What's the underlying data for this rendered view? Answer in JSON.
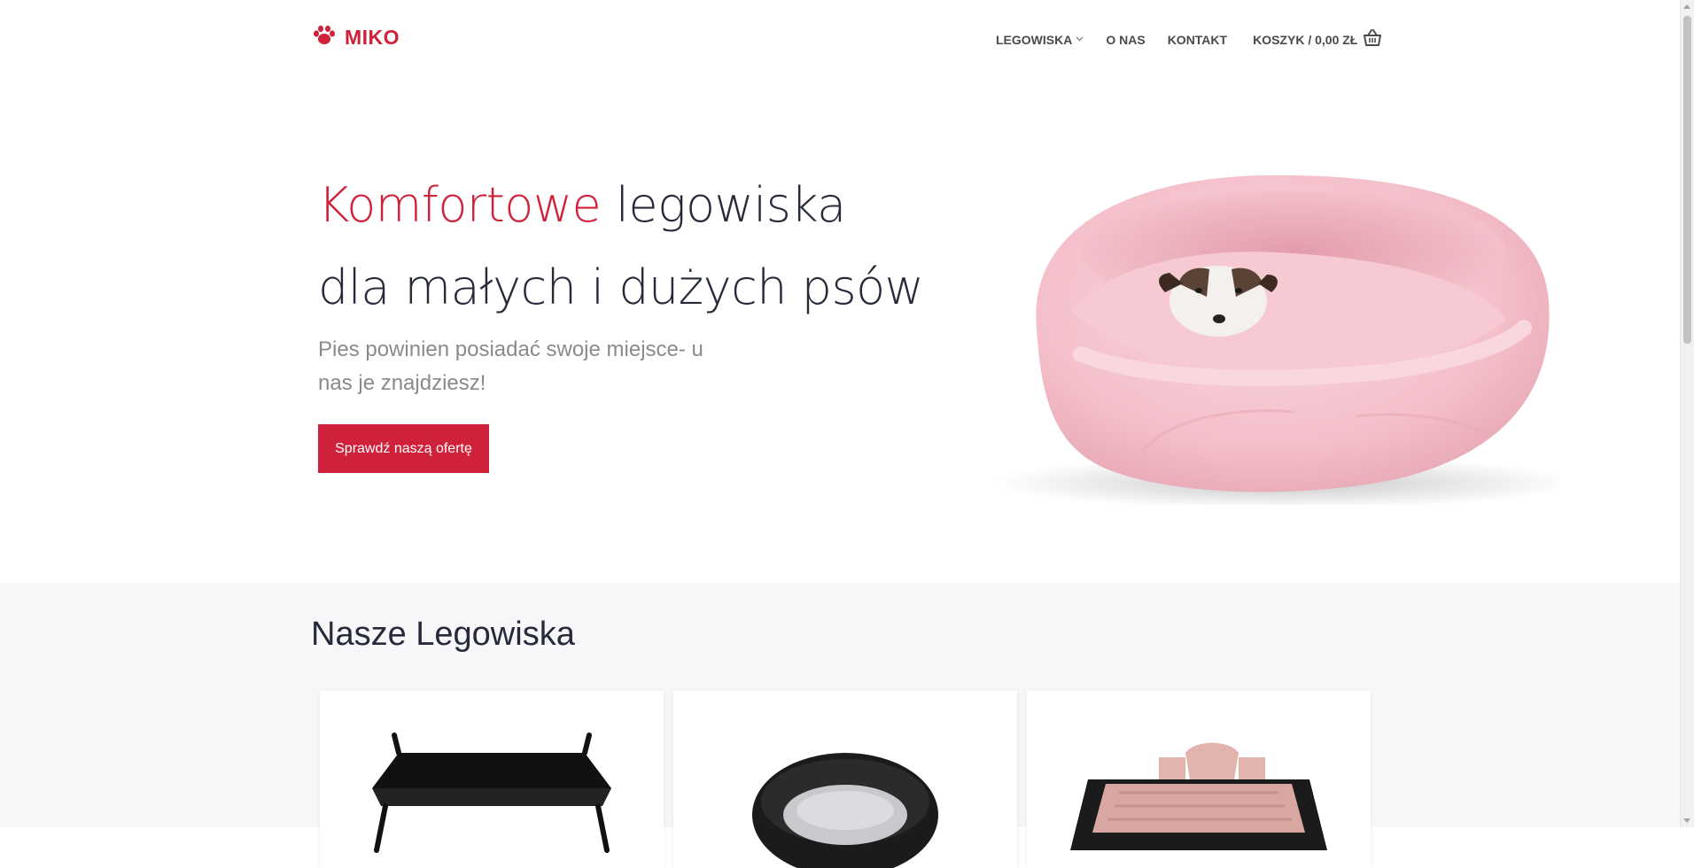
{
  "brand": {
    "name": "MIKO",
    "color": "#d0213a",
    "icon": "paw-icon"
  },
  "nav": {
    "items": [
      {
        "label": "LEGOWISKA",
        "has_dropdown": true
      },
      {
        "label": "O NAS"
      },
      {
        "label": "KONTAKT"
      }
    ],
    "cart": {
      "label": "KOSZYK / 0,00 ZŁ",
      "icon": "basket-icon"
    }
  },
  "hero": {
    "title_accent": "Komfortowe",
    "title_rest": " legowiska",
    "title_line2": "dla małych i dużych psów",
    "subtitle": "Pies powinien posiadać swoje miejsce- u nas je znajdziesz!",
    "cta_label": "Sprawdź naszą ofertę",
    "image": "pink-dog-bed-with-dog"
  },
  "products": {
    "title": "Nasze Legowiska",
    "cards": [
      {
        "image": "elevated-black-dog-cot"
      },
      {
        "image": "round-black-dog-bed"
      },
      {
        "image": "pink-black-rectangular-dog-bed"
      }
    ]
  },
  "colors": {
    "accent": "#d0213a",
    "text_dark": "#262a3a",
    "muted": "#8a8a8a",
    "section_bg": "#f7f7f9"
  }
}
